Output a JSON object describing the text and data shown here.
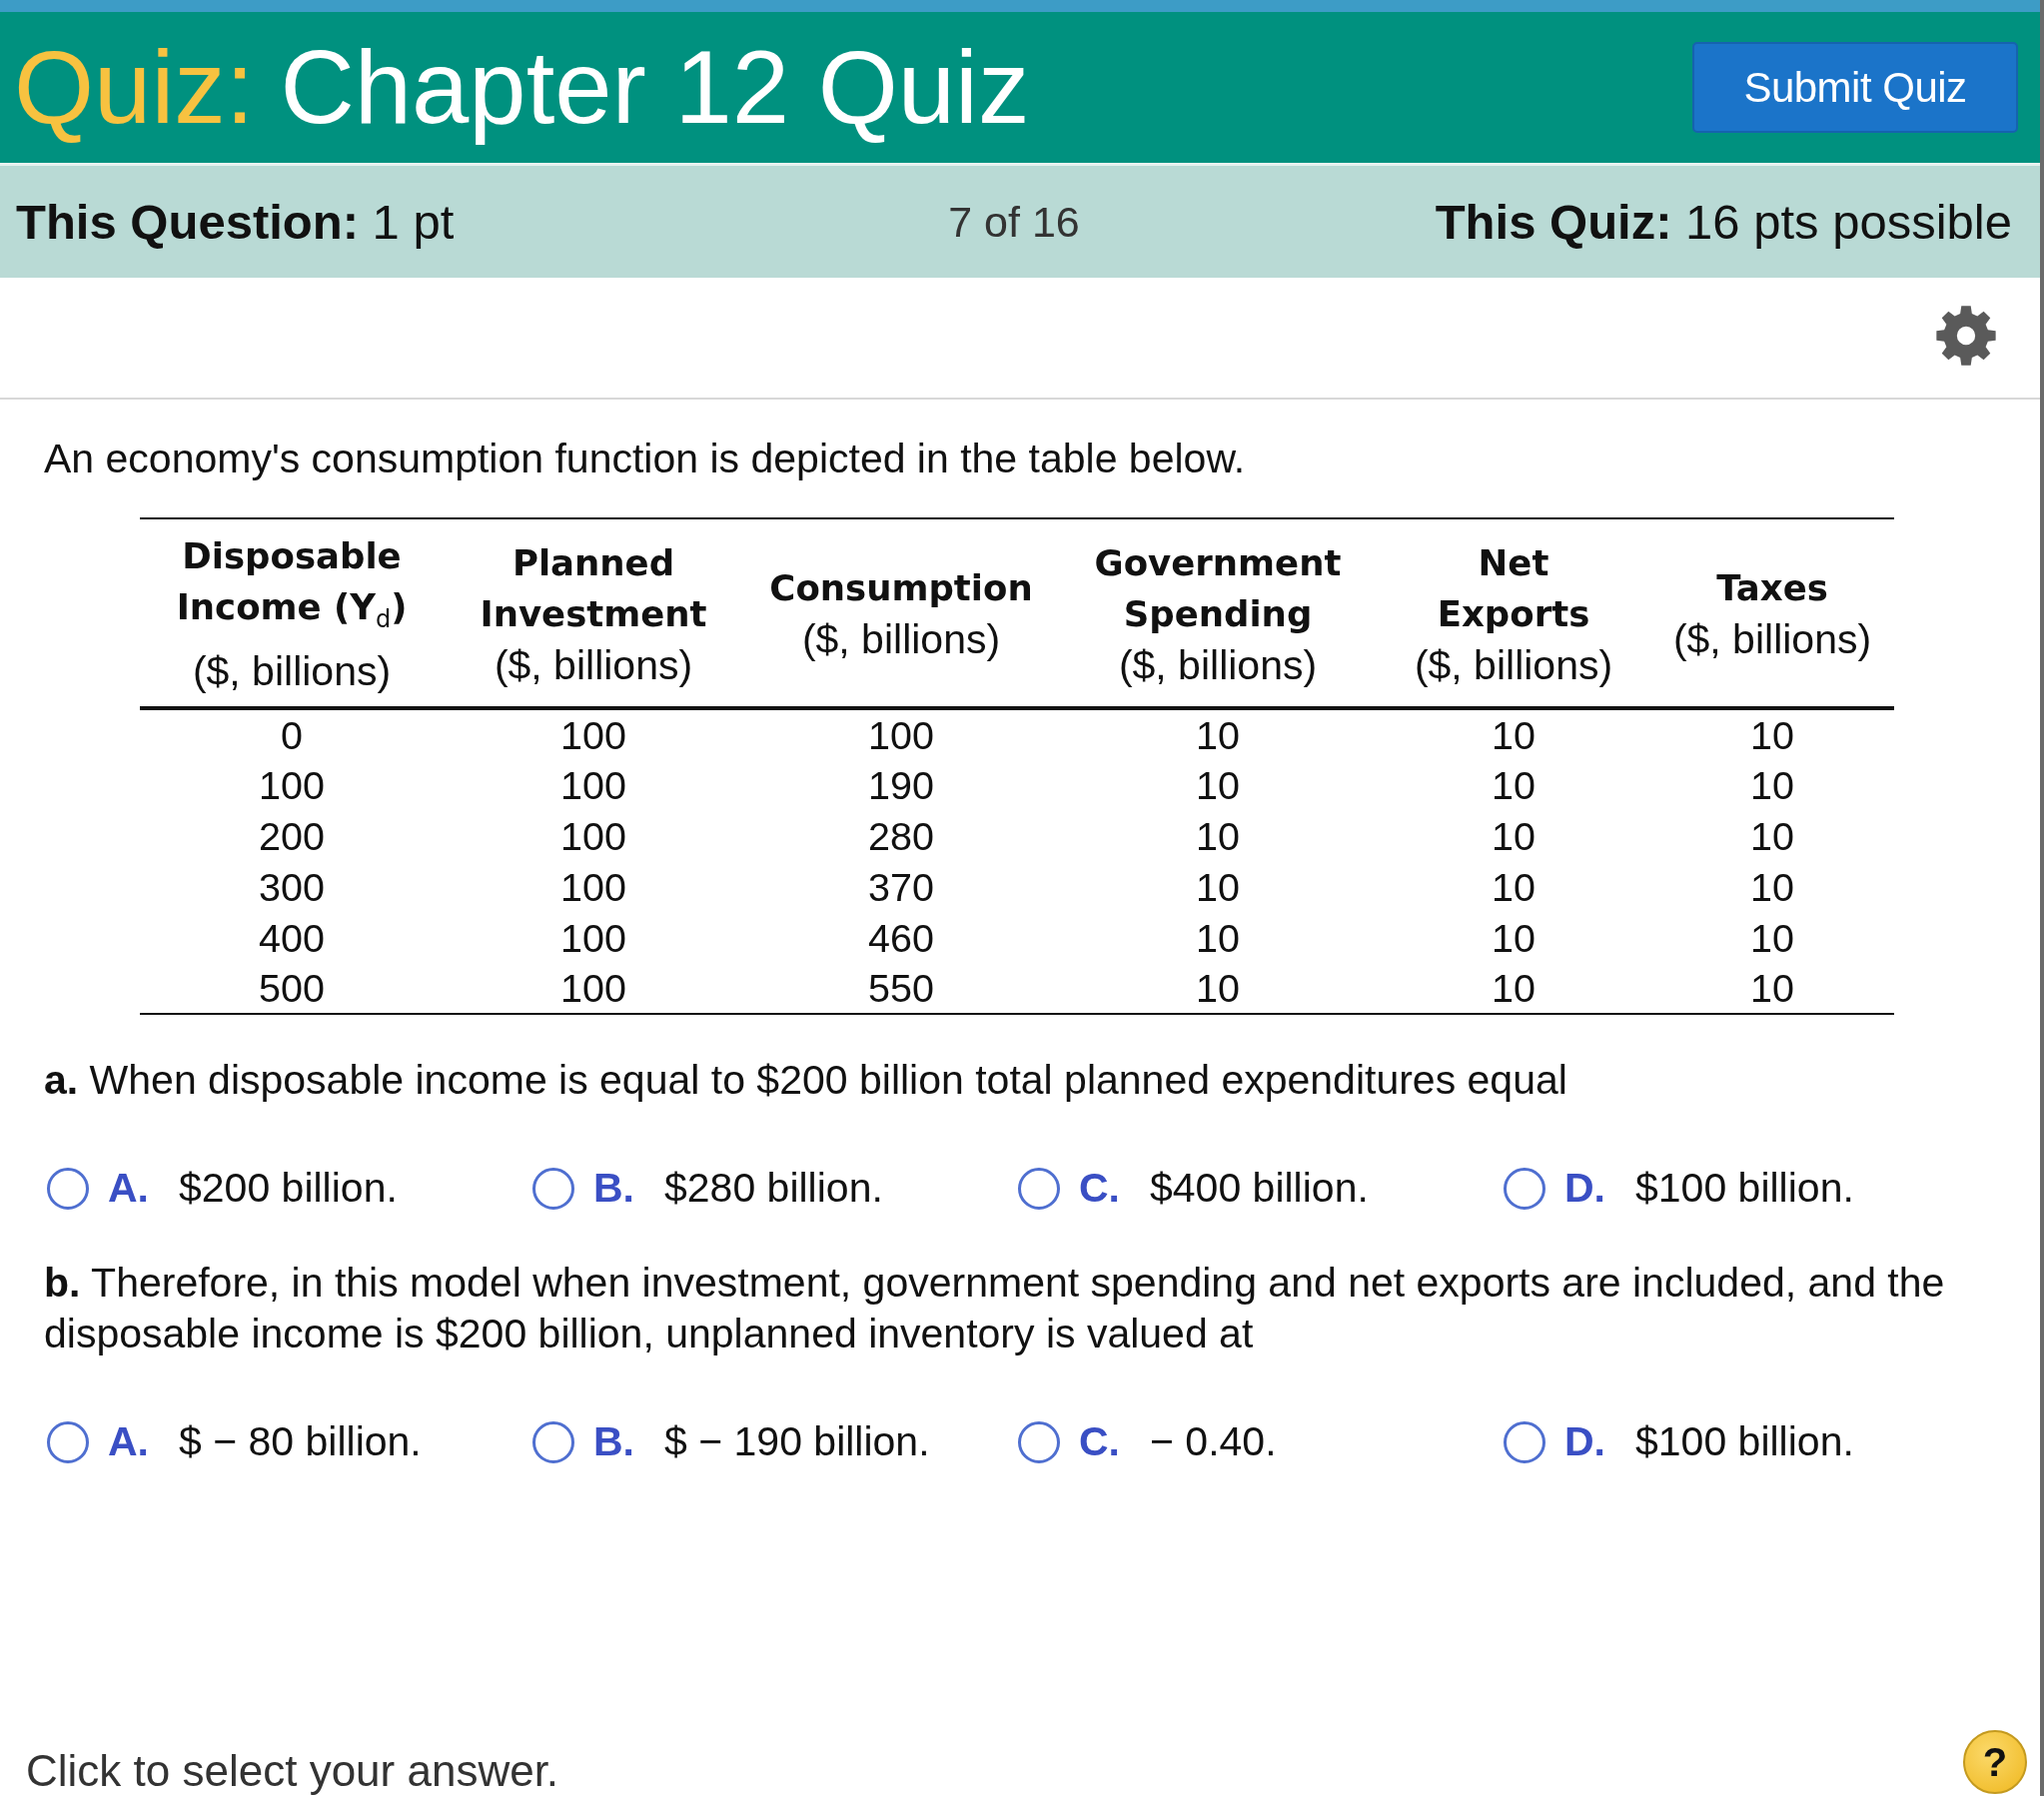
{
  "header": {
    "title_prefix": "Quiz:",
    "title": "Chapter 12 Quiz",
    "submit_button": "Submit Quiz"
  },
  "info_bar": {
    "question_points": "**This Question:** 1 pt",
    "progress": "7 of 16",
    "quiz_points": "**This Quiz:** 16 pts possible"
  },
  "question": {
    "intro": "An economy's consumption function is depicted in the table below.",
    "table": {
      "columns": [
        {
          "label": "Disposable\nIncome (Y$_{d}$)",
          "unit": "($, billions)"
        },
        {
          "label": "Planned\nInvestment",
          "unit": "($, billions)"
        },
        {
          "label": "Consumption",
          "unit": "($, billions)"
        },
        {
          "label": "Government\nSpending",
          "unit": "($, billions)"
        },
        {
          "label": "Net\nExports",
          "unit": "($, billions)"
        },
        {
          "label": "Taxes",
          "unit": "($, billions)"
        }
      ],
      "rows": [
        [
          "0",
          "100",
          "100",
          "10",
          "10",
          "10"
        ],
        [
          "100",
          "100",
          "190",
          "10",
          "10",
          "10"
        ],
        [
          "200",
          "100",
          "280",
          "10",
          "10",
          "10"
        ],
        [
          "300",
          "100",
          "370",
          "10",
          "10",
          "10"
        ],
        [
          "400",
          "100",
          "460",
          "10",
          "10",
          "10"
        ],
        [
          "500",
          "100",
          "550",
          "10",
          "10",
          "10"
        ]
      ]
    },
    "parts": [
      {
        "prompt": "**a.** When disposable income is equal to $200 billion total planned expenditures equal",
        "options": [
          {
            "letter": "A.",
            "text": "$200 billion.",
            "selected": false
          },
          {
            "letter": "B.",
            "text": "$280 billion.",
            "selected": false
          },
          {
            "letter": "C.",
            "text": "$400 billion.",
            "selected": false
          },
          {
            "letter": "D.",
            "text": "$100 billion.",
            "selected": false
          }
        ]
      },
      {
        "prompt": "**b.** Therefore, in this model when investment, government spending and net exports are included, and the disposable income is $200 billion, unplanned inventory is valued at",
        "options": [
          {
            "letter": "A.",
            "text": "$ − 80 billion.",
            "selected": false
          },
          {
            "letter": "B.",
            "text": "$ − 190 billion.",
            "selected": false
          },
          {
            "letter": "C.",
            "text": "− 0.40.",
            "selected": false
          },
          {
            "letter": "D.",
            "text": "$100 billion.",
            "selected": false
          }
        ]
      }
    ]
  },
  "footer": {
    "hint": "Click to select your answer.",
    "help_button": "?"
  }
}
